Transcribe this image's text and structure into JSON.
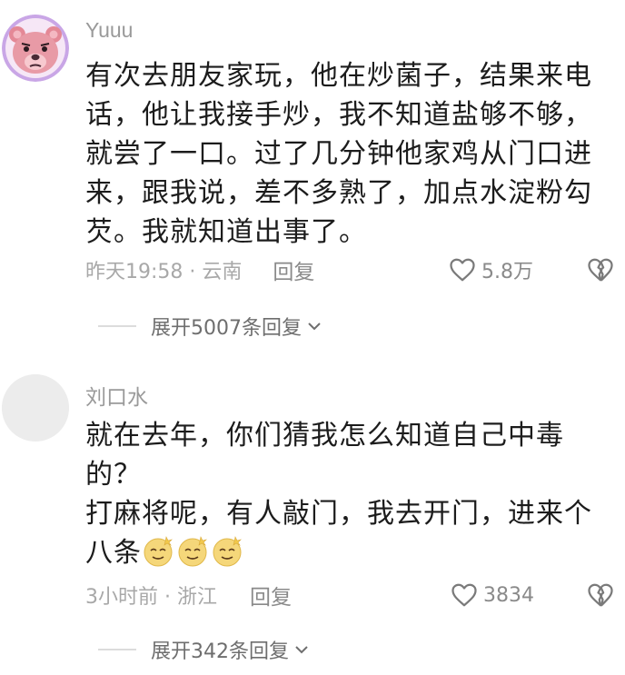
{
  "comments": [
    {
      "username": "Yuuu",
      "lines": [
        "有次去朋友家玩，他在炒菌子，结果来电",
        "话，他让我接手炒，我不知道盐够不够，",
        "就尝了一口。过了几分钟他家鸡从门口进",
        "来，跟我说，差不多熟了，加点水淀粉勾",
        "芡。我就知道出事了。"
      ],
      "time_location": "昨天19:58 · 云南",
      "reply_label": "回复",
      "like_count": "5.8万",
      "expand_label": "展开5007条回复",
      "avatar_icon": "pink-bear-avatar"
    },
    {
      "username": "刘口水",
      "lines": [
        "就在去年，你们猜我怎么知道自己中毒",
        "的？",
        "打麻将呢，有人敲门，我去开门，进来个",
        "八条"
      ],
      "emojis": [
        "dizzy-face-emoji",
        "dizzy-face-emoji",
        "dizzy-face-emoji"
      ],
      "time_location": "3小时前 · 浙江",
      "reply_label": "回复",
      "like_count": "3834",
      "expand_label": "展开342条回复",
      "avatar_icon": "blank-avatar"
    }
  ],
  "colors": {
    "username": "#9a9a9a",
    "text": "#1c1c1c",
    "meta": "#a8a8a8",
    "avatar_ring": "#c9a6e6",
    "bear": "#e89aa6"
  }
}
